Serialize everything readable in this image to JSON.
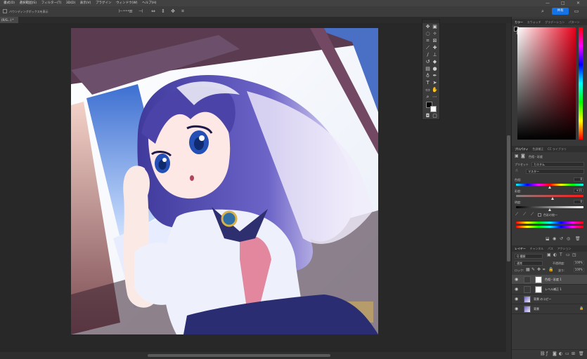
{
  "menubar": {
    "items": [
      "書式(O)",
      "選択範囲(S)",
      "フィルター(T)",
      "3D(D)",
      "表示(V)",
      "プラグイン",
      "ウィンドウ(W)",
      "ヘルプ(H)"
    ],
    "window_controls": [
      "—",
      "□",
      "✕"
    ]
  },
  "options_bar": {
    "checkbox_label": "バウンディングボックスを表示",
    "more_icon": "•••",
    "share_label": "共有"
  },
  "document_tab": {
    "label": "(R/G...) *"
  },
  "tools": [
    "move-icon",
    "artboard-icon",
    "lasso-icon",
    "magic-wand-icon",
    "crop-icon",
    "frame-icon",
    "eyedropper-icon",
    "spot-heal-icon",
    "brush-icon",
    "stamp-icon",
    "history-brush-icon",
    "eraser-icon",
    "gradient-icon",
    "blur-icon",
    "dodge-icon",
    "pen-icon",
    "type-icon",
    "path-select-icon",
    "rectangle-icon",
    "hand-icon",
    "zoom-icon",
    "more-tools-icon"
  ],
  "color_panel": {
    "tabs": [
      "カラー",
      "スウォッチ",
      "グラデーション",
      "パターン"
    ],
    "active_tab": 0,
    "foreground": "#000000",
    "background": "#ffffff",
    "hue_color": "#e8001a"
  },
  "properties_panel": {
    "tabs": [
      "プロパティ",
      "色調補正",
      "CC ライブラリ"
    ],
    "adjustment_name": "色相・彩度",
    "preset_label": "プリセット",
    "preset_value": "カスタム",
    "channel_value": "マスター",
    "hue_label": "色相:",
    "hue_value": "0",
    "saturation_label": "彩度:",
    "saturation_value": "+11",
    "lightness_label": "明度:",
    "lightness_value": "0",
    "colorize_label": "色彩の統一",
    "hue_position": 0.5,
    "saturation_position": 0.55,
    "lightness_position": 0.5
  },
  "layers_panel": {
    "tabs": [
      "レイヤー",
      "チャンネル",
      "パス",
      "アクション",
      "ヒストリー"
    ],
    "filter_label": "Q 種類",
    "blend_mode": "通常",
    "opacity_label": "不透明度:",
    "opacity_value": "100%",
    "lock_label": "ロック:",
    "fill_label": "塗り:",
    "fill_value": "100%",
    "layers": [
      {
        "name": "色相・彩度 1",
        "kind": "adjustment"
      },
      {
        "name": "レベル補正 1",
        "kind": "adjustment"
      },
      {
        "name": "背景 のコピー",
        "kind": "image"
      },
      {
        "name": "背景",
        "kind": "image-locked"
      }
    ]
  }
}
